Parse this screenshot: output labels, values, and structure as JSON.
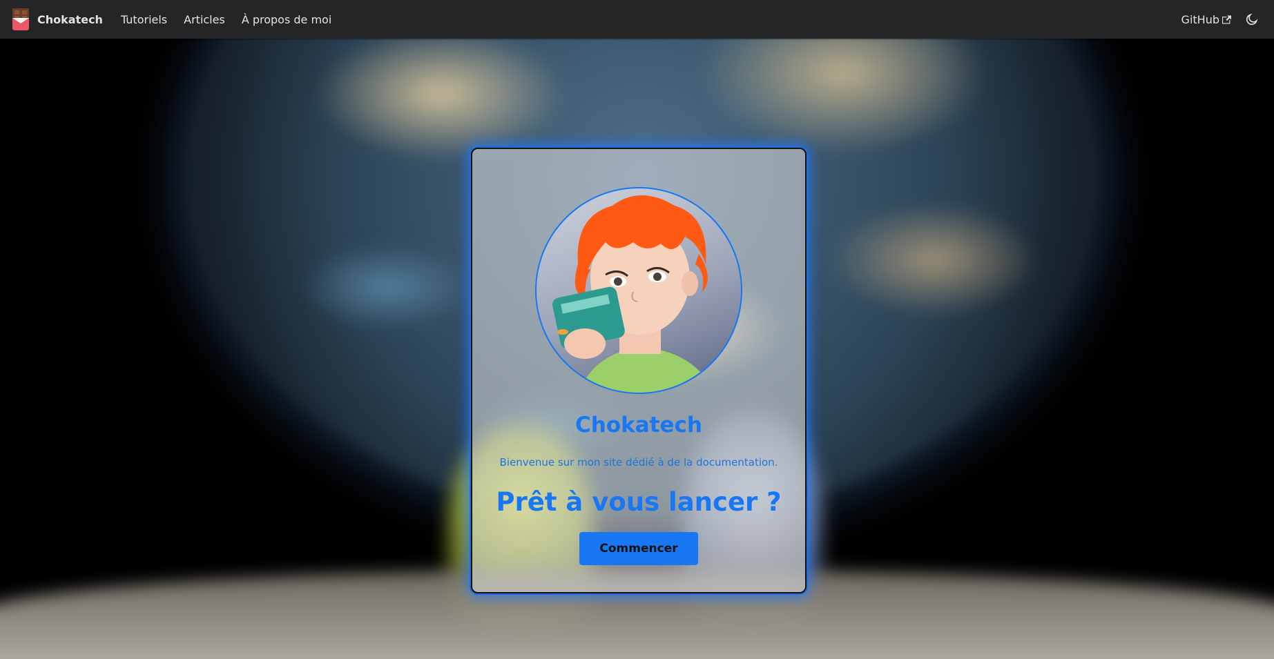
{
  "navbar": {
    "brand": "Chokatech",
    "links": [
      "Tutoriels",
      "Articles",
      "À propos de moi"
    ],
    "github": "GitHub",
    "icons": {
      "logo": "chocolate-bar-logo",
      "external": "external-link-icon",
      "theme": "moon-icon"
    }
  },
  "card": {
    "title": "Chokatech",
    "description": "Bienvenue sur mon site dédié à de la documentation.",
    "cta": "Prêt à vous lancer ?",
    "button": "Commencer"
  },
  "colors": {
    "accent": "#1877f2",
    "navbar_bg": "#242526",
    "nav_text": "#e3e3e3"
  }
}
